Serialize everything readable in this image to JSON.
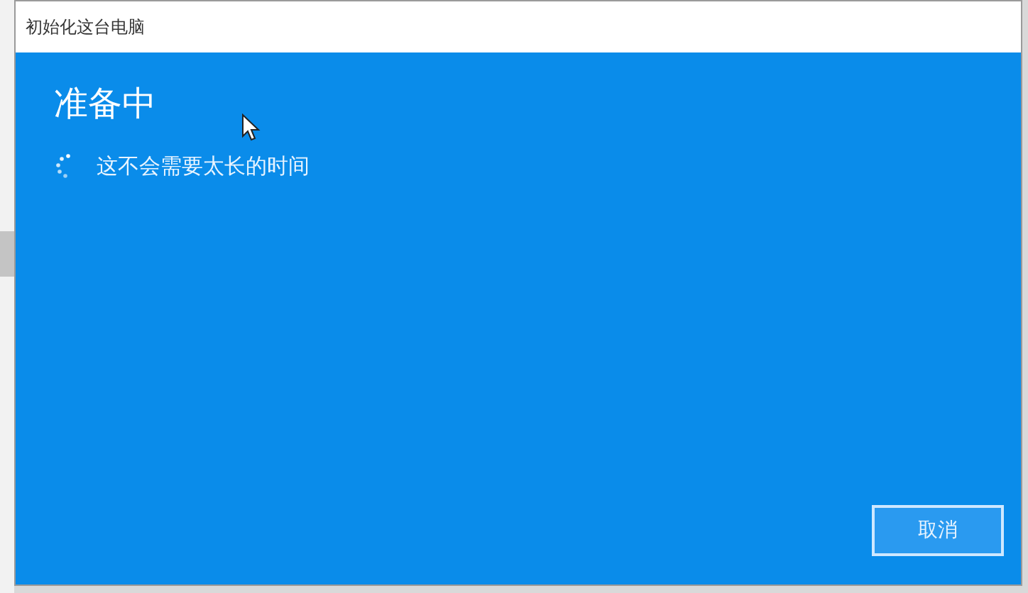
{
  "window": {
    "title": "初始化这台电脑"
  },
  "heading": "准备中",
  "status": {
    "text": "这不会需要太长的时间"
  },
  "buttons": [
    {
      "label": "取消"
    }
  ]
}
